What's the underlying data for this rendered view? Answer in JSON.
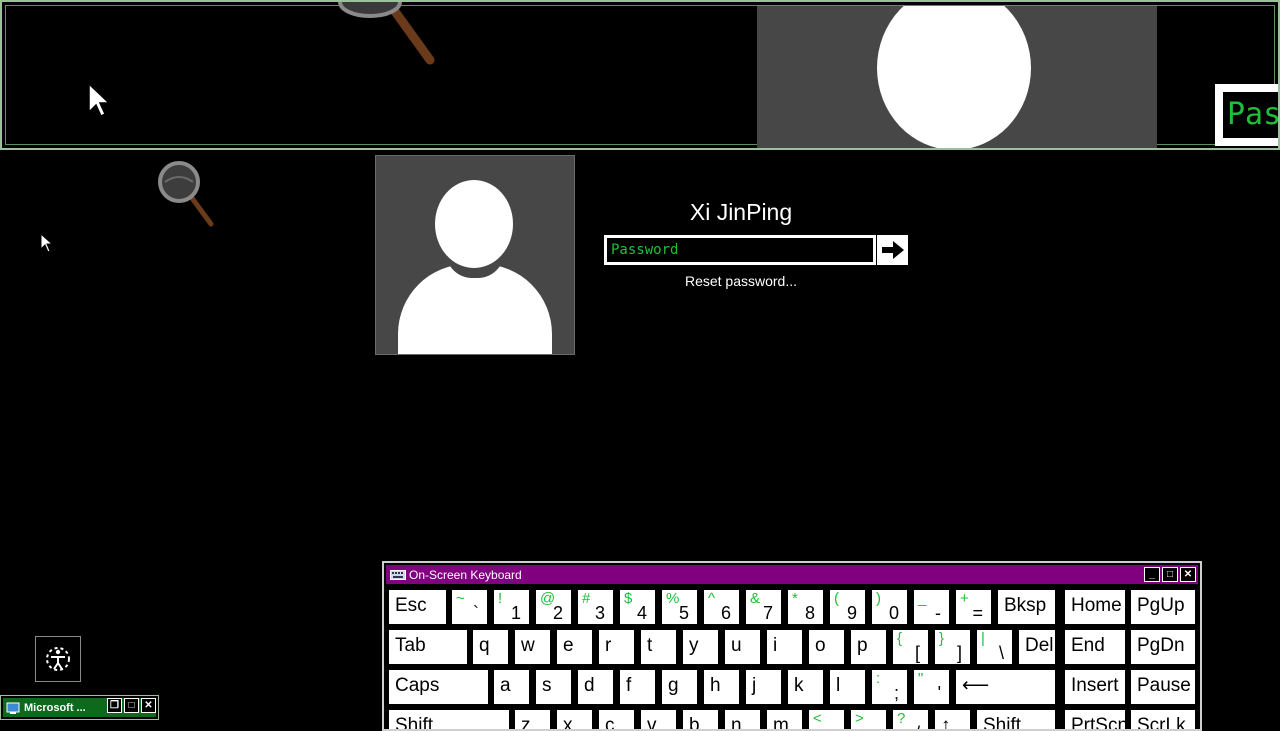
{
  "magnifier": {
    "password_text": "Pas"
  },
  "login": {
    "username": "Xi JinPing",
    "password_placeholder": "Password",
    "reset_link": "Reset password..."
  },
  "taskbar": {
    "minimized_title": "Microsoft ..."
  },
  "osk": {
    "title": "On-Screen Keyboard",
    "rows": [
      [
        {
          "main": "Esc"
        },
        {
          "shift": "~",
          "main": "`"
        },
        {
          "shift": "!",
          "main": "1"
        },
        {
          "shift": "@",
          "main": "2"
        },
        {
          "shift": "#",
          "main": "3"
        },
        {
          "shift": "$",
          "main": "4"
        },
        {
          "shift": "%",
          "main": "5"
        },
        {
          "shift": "^",
          "main": "6"
        },
        {
          "shift": "&",
          "main": "7"
        },
        {
          "shift": "*",
          "main": "8"
        },
        {
          "shift": "(",
          "main": "9"
        },
        {
          "shift": ")",
          "main": "0"
        },
        {
          "shift": "_",
          "main": "-"
        },
        {
          "shift": "+",
          "main": "="
        },
        {
          "main": "Bksp"
        },
        {
          "main": "Home"
        },
        {
          "main": "PgUp"
        }
      ],
      [
        {
          "main": "Tab"
        },
        {
          "main": "q"
        },
        {
          "main": "w"
        },
        {
          "main": "e"
        },
        {
          "main": "r"
        },
        {
          "main": "t"
        },
        {
          "main": "y"
        },
        {
          "main": "u"
        },
        {
          "main": "i"
        },
        {
          "main": "o"
        },
        {
          "main": "p"
        },
        {
          "shift": "{",
          "main": "["
        },
        {
          "shift": "}",
          "main": "]"
        },
        {
          "shift": "|",
          "main": "\\"
        },
        {
          "main": "Del"
        },
        {
          "main": "End"
        },
        {
          "main": "PgDn"
        }
      ],
      [
        {
          "main": "Caps"
        },
        {
          "main": "a"
        },
        {
          "main": "s"
        },
        {
          "main": "d"
        },
        {
          "main": "f"
        },
        {
          "main": "g"
        },
        {
          "main": "h"
        },
        {
          "main": "j"
        },
        {
          "main": "k"
        },
        {
          "main": "l"
        },
        {
          "shift": ":",
          "main": ";"
        },
        {
          "shift": "\"",
          "main": "'"
        },
        {
          "main": "⟵"
        },
        {
          "main": "Insert"
        },
        {
          "main": "Pause"
        }
      ],
      [
        {
          "main": "Shift"
        },
        {
          "main": "z"
        },
        {
          "main": "x"
        },
        {
          "main": "c"
        },
        {
          "main": "v"
        },
        {
          "main": "b"
        },
        {
          "main": "n"
        },
        {
          "main": "m"
        },
        {
          "shift": "<",
          "main": ","
        },
        {
          "shift": ">",
          "main": "."
        },
        {
          "shift": "?",
          "main": "/"
        },
        {
          "main": "↑"
        },
        {
          "main": "Shift"
        },
        {
          "main": "PrtScn"
        },
        {
          "main": "ScrLk"
        }
      ]
    ]
  },
  "icons": {
    "arrow": "arrow-right-icon",
    "ease": "ease-of-access-icon",
    "magnifier": "magnifier-icon",
    "cursor": "mouse-pointer-icon"
  }
}
